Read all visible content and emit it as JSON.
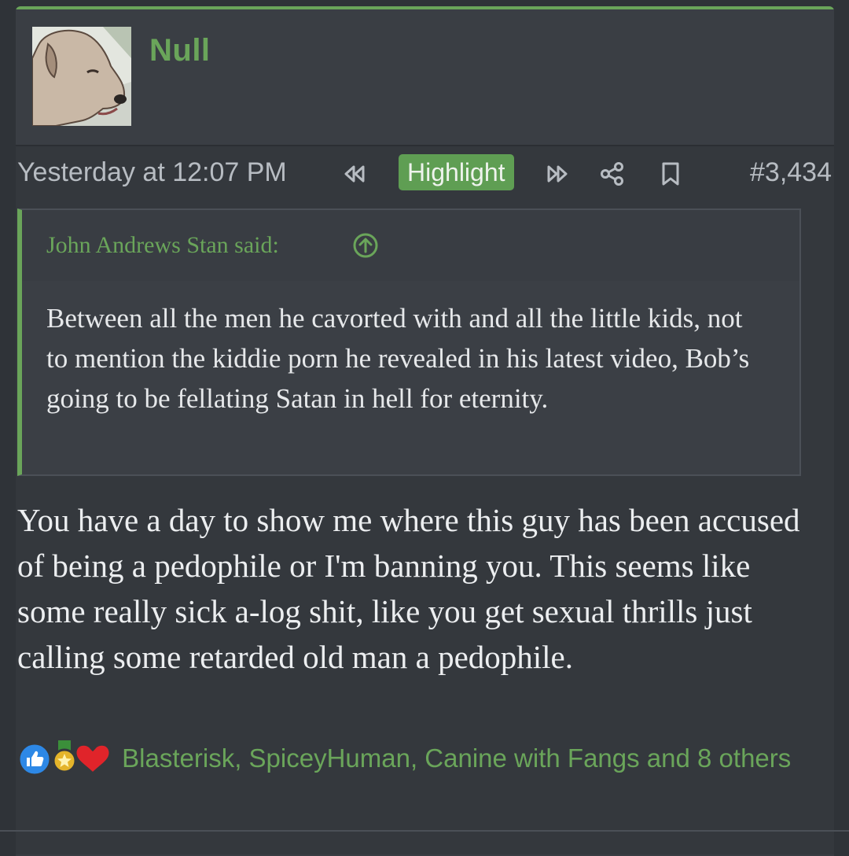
{
  "user": {
    "name": "Null"
  },
  "meta": {
    "timestamp": "Yesterday at 12:07 PM",
    "highlight_label": "Highlight",
    "post_number": "#3,434"
  },
  "quote": {
    "attribution": "John Andrews Stan said:",
    "text": "Between all the men he cavorted with and all the little kids, not to mention the kiddie porn he revealed in his latest video, Bob’s going to be fellating Satan in hell for eternity."
  },
  "body": {
    "text": "You have a day to show me where this guy has been accused of being a pedophile or I'm banning you. This seems like some really sick a-log shit, like you get sexual thrills just calling some retarded old man a pedophile."
  },
  "reactions": {
    "icons": [
      "like-icon",
      "medal-icon",
      "heart-icon"
    ],
    "summary": "Blasterisk, SpiceyHuman, Canine with Fangs and 8 others"
  },
  "colors": {
    "accent": "#6aa55a",
    "background": "#34383d",
    "text": "#eceef0"
  }
}
